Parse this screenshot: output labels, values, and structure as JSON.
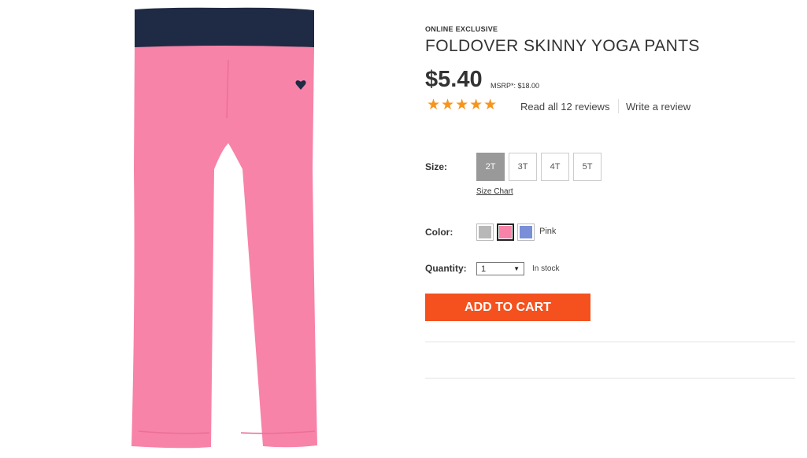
{
  "product": {
    "eyebrow": "ONLINE EXCLUSIVE",
    "title": "FOLDOVER SKINNY YOGA PANTS",
    "price": "$5.40",
    "msrp": "MSRP*: $18.00",
    "image_alt": "Pink foldover skinny yoga pants with navy waistband",
    "image_colors": {
      "waistband": "#1f2a44",
      "pants": "#f783a8",
      "heart": "#1f2a44"
    }
  },
  "rating": {
    "stars": "★★★★★",
    "value": 5,
    "max": 5,
    "star_color": "#f7941d",
    "reviews_link": "Read all 12 reviews",
    "write_review": "Write a review"
  },
  "size": {
    "label": "Size:",
    "options": [
      "2T",
      "3T",
      "4T",
      "5T"
    ],
    "selected": "2T",
    "size_chart": "Size Chart"
  },
  "color": {
    "label": "Color:",
    "swatches": [
      {
        "name": "gray-swatch",
        "hex": "#b8b8b8"
      },
      {
        "name": "pink-swatch",
        "hex": "#f783a8"
      },
      {
        "name": "periwinkle-swatch",
        "hex": "#7a8fd8"
      }
    ],
    "selected": "Pink"
  },
  "quantity": {
    "label": "Quantity:",
    "value": "1",
    "stock": "In stock"
  },
  "cart": {
    "add_label": "ADD TO CART",
    "button_color": "#f4511e"
  }
}
